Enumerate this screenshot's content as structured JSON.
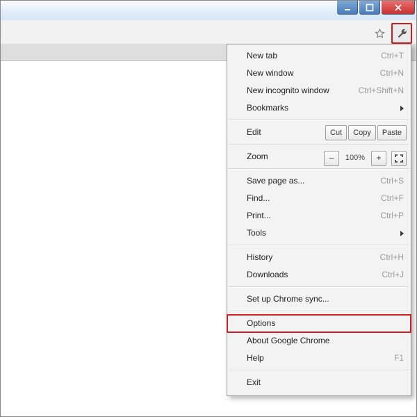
{
  "menu": {
    "new_tab": {
      "label": "New tab",
      "shortcut": "Ctrl+T"
    },
    "new_window": {
      "label": "New window",
      "shortcut": "Ctrl+N"
    },
    "new_incognito": {
      "label": "New incognito window",
      "shortcut": "Ctrl+Shift+N"
    },
    "bookmarks": {
      "label": "Bookmarks"
    },
    "edit": {
      "label": "Edit",
      "cut": "Cut",
      "copy": "Copy",
      "paste": "Paste"
    },
    "zoom": {
      "label": "Zoom",
      "minus": "–",
      "level": "100%",
      "plus": "+"
    },
    "save_page": {
      "label": "Save page as...",
      "shortcut": "Ctrl+S"
    },
    "find": {
      "label": "Find...",
      "shortcut": "Ctrl+F"
    },
    "print": {
      "label": "Print...",
      "shortcut": "Ctrl+P"
    },
    "tools": {
      "label": "Tools"
    },
    "history": {
      "label": "History",
      "shortcut": "Ctrl+H"
    },
    "downloads": {
      "label": "Downloads",
      "shortcut": "Ctrl+J"
    },
    "sync": {
      "label": "Set up Chrome sync..."
    },
    "options": {
      "label": "Options"
    },
    "about": {
      "label": "About Google Chrome"
    },
    "help": {
      "label": "Help",
      "shortcut": "F1"
    },
    "exit": {
      "label": "Exit"
    }
  }
}
